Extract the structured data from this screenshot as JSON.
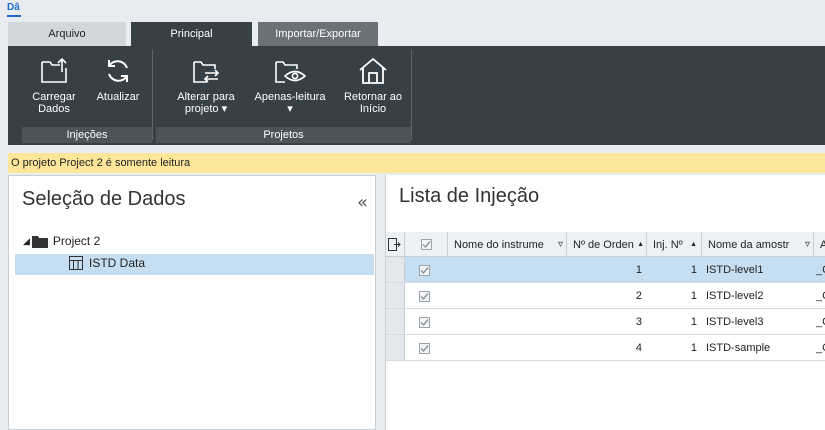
{
  "app": {
    "logo_text": "Dâ"
  },
  "tabs": [
    {
      "label": "Arquivo"
    },
    {
      "label": "Principal"
    },
    {
      "label": "Importar/Exportar"
    }
  ],
  "ribbon": {
    "buttons": {
      "carregar": {
        "line1": "Carregar",
        "line2": "Dados",
        "icon": "folder-upload-icon"
      },
      "atualizar": {
        "line1": "Atualizar",
        "icon": "refresh-icon"
      },
      "alterar": {
        "line1": "Alterar para",
        "line2": "projeto",
        "icon": "folder-switch-icon"
      },
      "apenas": {
        "line1": "Apenas-leitura",
        "icon": "folder-eye-icon"
      },
      "retornar": {
        "line1": "Retornar ao",
        "line2": "Início",
        "icon": "home-icon"
      }
    },
    "groups": {
      "injecoes": "Injeções",
      "projetos": "Projetos"
    }
  },
  "notice": "O projeto Project 2 é somente leitura",
  "left_panel": {
    "title": "Seleção de Dados",
    "tree": {
      "project": "Project 2",
      "item": "ISTD Data"
    }
  },
  "right_panel": {
    "title": "Lista de Injeção",
    "columns": [
      "Nome do instrume",
      "Nº de Orden",
      "Inj. Nº",
      "Nome da amostr",
      "A"
    ],
    "rows": [
      {
        "order": "1",
        "inj": "1",
        "sample": "ISTD-level1",
        "extra": "_C"
      },
      {
        "order": "2",
        "inj": "1",
        "sample": "ISTD-level2",
        "extra": "_C"
      },
      {
        "order": "3",
        "inj": "1",
        "sample": "ISTD-level3",
        "extra": "_C"
      },
      {
        "order": "4",
        "inj": "1",
        "sample": "ISTD-sample",
        "extra": "_C"
      }
    ]
  },
  "colors": {
    "ribbon_bg": "#373f47",
    "notice_bg": "#fde59a",
    "selection": "#c6def1",
    "logo": "#1e6cc8"
  }
}
